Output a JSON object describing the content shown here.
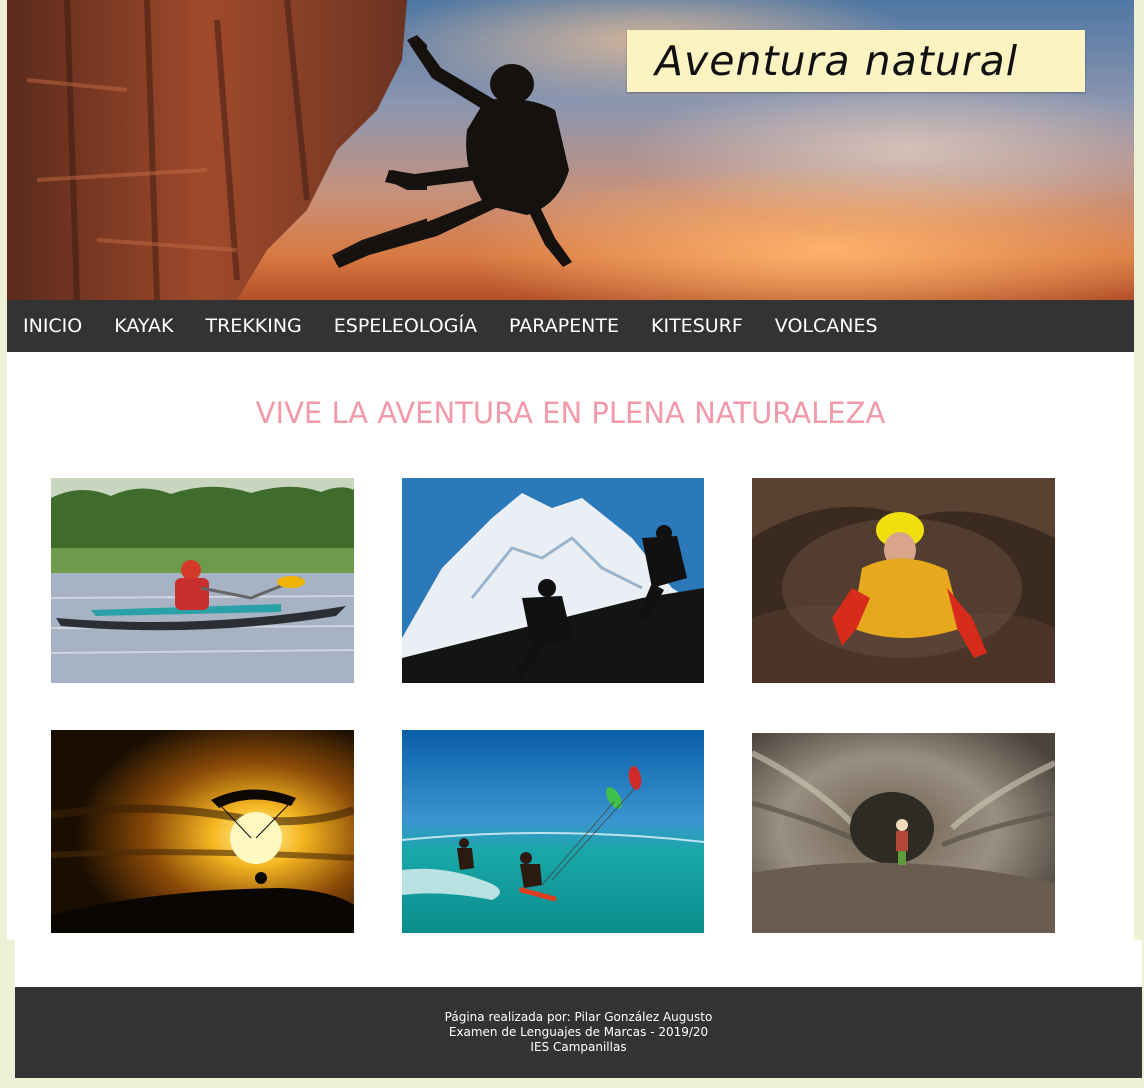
{
  "banner": {
    "logo_text": "Aventura natural"
  },
  "nav": {
    "items": [
      "INICIO",
      "KAYAK",
      "TREKKING",
      "ESPELEOLOGÍA",
      "PARAPENTE",
      "KITESURF",
      "VOLCANES"
    ]
  },
  "main": {
    "headline": "VIVE LA AVENTURA EN PLENA NATURALEZA"
  },
  "gallery": {
    "tiles": [
      "kayak-photo",
      "trekking-photo",
      "speleology-photo",
      "paragliding-photo",
      "kitesurf-photo",
      "volcano-tunnel-photo"
    ]
  },
  "footer": {
    "line1": "Página realizada por: Pilar González Augusto",
    "line2": "Examen de Lenguajes de Marcas - 2019/20",
    "line3": "IES Campanillas"
  },
  "colors": {
    "nav_bg": "#333333",
    "headline": "#f19aa9",
    "logo_bg": "#fbf4c2",
    "page_bg": "#eef0d6"
  }
}
